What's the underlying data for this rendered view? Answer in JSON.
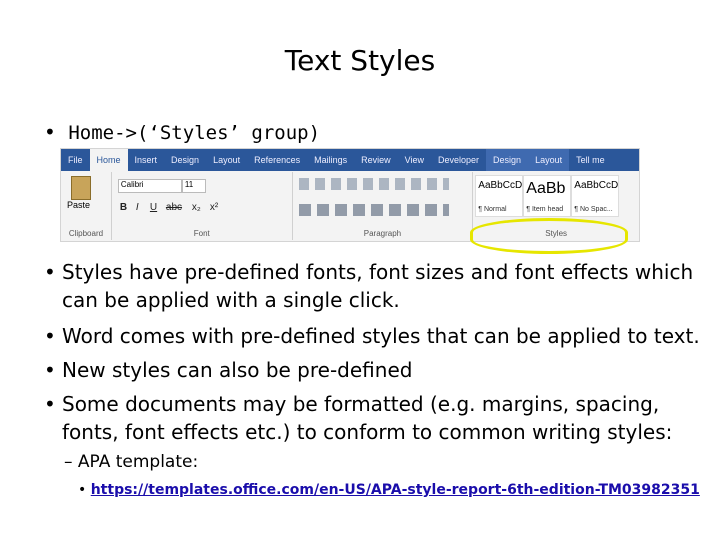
{
  "title": "Text Styles",
  "intro": "Home->(‘Styles’ group)",
  "ribbon": {
    "tabs": [
      "File",
      "Home",
      "Insert",
      "Design",
      "Layout",
      "References",
      "Mailings",
      "Review",
      "View",
      "Developer",
      "Design",
      "Layout",
      "Tell me"
    ],
    "clipboard": {
      "paste_label": "Paste",
      "group_label": "Clipboard"
    },
    "font": {
      "name": "Calibri",
      "size": "11",
      "group_label": "Font",
      "buttons": [
        "B",
        "I",
        "U",
        "abc",
        "x₂",
        "x²"
      ]
    },
    "paragraph": {
      "group_label": "Paragraph"
    },
    "styles": {
      "group_label": "Styles",
      "items": [
        {
          "preview": "AaBbCcD",
          "name": "¶ Normal"
        },
        {
          "preview": "AaBb",
          "name": "¶ Item head"
        },
        {
          "preview": "AaBbCcD",
          "name": "¶ No Spac..."
        }
      ]
    }
  },
  "bullets": [
    "Styles have pre-defined fonts, font sizes and font effects which",
    "can be applied with a single click.",
    "Word comes with pre-defined styles that can be applied to text.",
    "New styles can also be pre-defined",
    "Some documents may be formatted (e.g. margins, spacing,",
    "fonts, font effects etc.) to conform to common writing styles:"
  ],
  "sub_bullet": "– APA template:",
  "link": "https://templates.office.com/en-US/APA-style-report-6th-edition-TM03982351",
  "colors": {
    "ribbon_blue": "#2b579a",
    "highlight": "#e6e600",
    "link": "#1a0dab"
  }
}
